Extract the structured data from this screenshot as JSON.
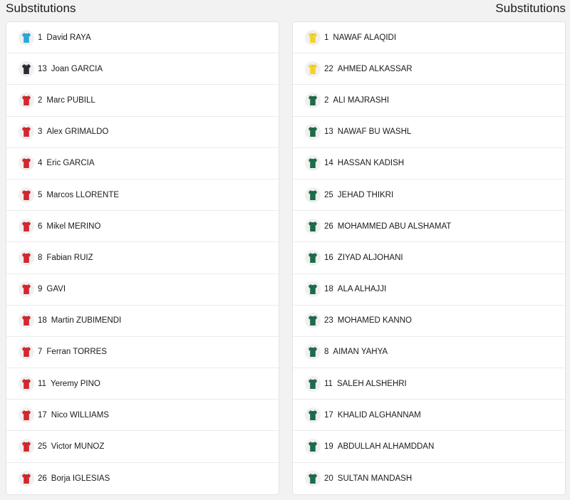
{
  "left": {
    "title": "Substitutions",
    "players": [
      {
        "number": "1",
        "name": "David RAYA",
        "kit": "gk-cyan"
      },
      {
        "number": "13",
        "name": "Joan GARCIA",
        "kit": "gk-dark"
      },
      {
        "number": "2",
        "name": "Marc PUBILL",
        "kit": "red"
      },
      {
        "number": "3",
        "name": "Alex GRIMALDO",
        "kit": "red"
      },
      {
        "number": "4",
        "name": "Eric GARCIA",
        "kit": "red"
      },
      {
        "number": "5",
        "name": "Marcos LLORENTE",
        "kit": "red"
      },
      {
        "number": "6",
        "name": "Mikel MERINO",
        "kit": "red"
      },
      {
        "number": "8",
        "name": "Fabian RUIZ",
        "kit": "red"
      },
      {
        "number": "9",
        "name": "GAVI",
        "kit": "red"
      },
      {
        "number": "18",
        "name": "Martin ZUBIMENDI",
        "kit": "red"
      },
      {
        "number": "7",
        "name": "Ferran TORRES",
        "kit": "red"
      },
      {
        "number": "11",
        "name": "Yeremy PINO",
        "kit": "red"
      },
      {
        "number": "17",
        "name": "Nico WILLIAMS",
        "kit": "red"
      },
      {
        "number": "25",
        "name": "Victor MUNOZ",
        "kit": "red"
      },
      {
        "number": "26",
        "name": "Borja IGLESIAS",
        "kit": "red"
      }
    ]
  },
  "right": {
    "title": "Substitutions",
    "players": [
      {
        "number": "1",
        "name": "NAWAF ALAQIDI",
        "kit": "gk-yellow"
      },
      {
        "number": "22",
        "name": "AHMED ALKASSAR",
        "kit": "gk-yellow"
      },
      {
        "number": "2",
        "name": "ALI MAJRASHI",
        "kit": "green"
      },
      {
        "number": "13",
        "name": "NAWAF BU WASHL",
        "kit": "green"
      },
      {
        "number": "14",
        "name": "HASSAN KADISH",
        "kit": "green"
      },
      {
        "number": "25",
        "name": "JEHAD THIKRI",
        "kit": "green"
      },
      {
        "number": "26",
        "name": "MOHAMMED ABU ALSHAMAT",
        "kit": "green"
      },
      {
        "number": "16",
        "name": "ZIYAD ALJOHANI",
        "kit": "green"
      },
      {
        "number": "18",
        "name": "ALA ALHAJJI",
        "kit": "green"
      },
      {
        "number": "23",
        "name": "MOHAMED KANNO",
        "kit": "green"
      },
      {
        "number": "8",
        "name": "AIMAN YAHYA",
        "kit": "green"
      },
      {
        "number": "11",
        "name": "SALEH ALSHEHRI",
        "kit": "green"
      },
      {
        "number": "17",
        "name": "KHALID ALGHANNAM",
        "kit": "green"
      },
      {
        "number": "19",
        "name": "ABDULLAH ALHAMDDAN",
        "kit": "green"
      },
      {
        "number": "20",
        "name": "SULTAN MANDASH",
        "kit": "green"
      }
    ]
  },
  "kit_colors": {
    "gk-cyan": {
      "body": "#29a8d8",
      "trim": "#1a6f96"
    },
    "gk-dark": {
      "body": "#2b2b33",
      "trim": "#6b6b78"
    },
    "red": {
      "body": "#d4262e",
      "trim": "#7a1116"
    },
    "gk-yellow": {
      "body": "#f2d32e",
      "trim": "#b8961a"
    },
    "green": {
      "body": "#1e6b4a",
      "trim": "#0f3d29"
    }
  }
}
